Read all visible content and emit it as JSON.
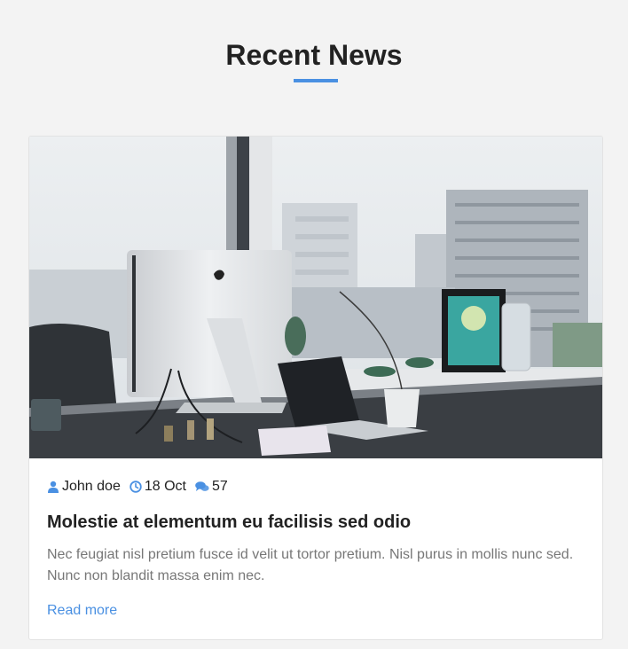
{
  "section": {
    "heading": "Recent News",
    "accent_color": "#4a90e2"
  },
  "post": {
    "image_alt": "Office desk with desktop computer and laptop by a window overlooking city buildings",
    "author": "John doe",
    "date": "18 Oct",
    "comments": "57",
    "icons": {
      "author": "user-icon",
      "date": "clock-icon",
      "comments": "comments-icon"
    },
    "title": "Molestie at elementum eu facilisis sed odio",
    "excerpt": "Nec feugiat nisl pretium fusce id velit ut tortor pretium. Nisl purus in mollis nunc sed. Nunc non blandit massa enim nec.",
    "read_more": "Read more"
  }
}
